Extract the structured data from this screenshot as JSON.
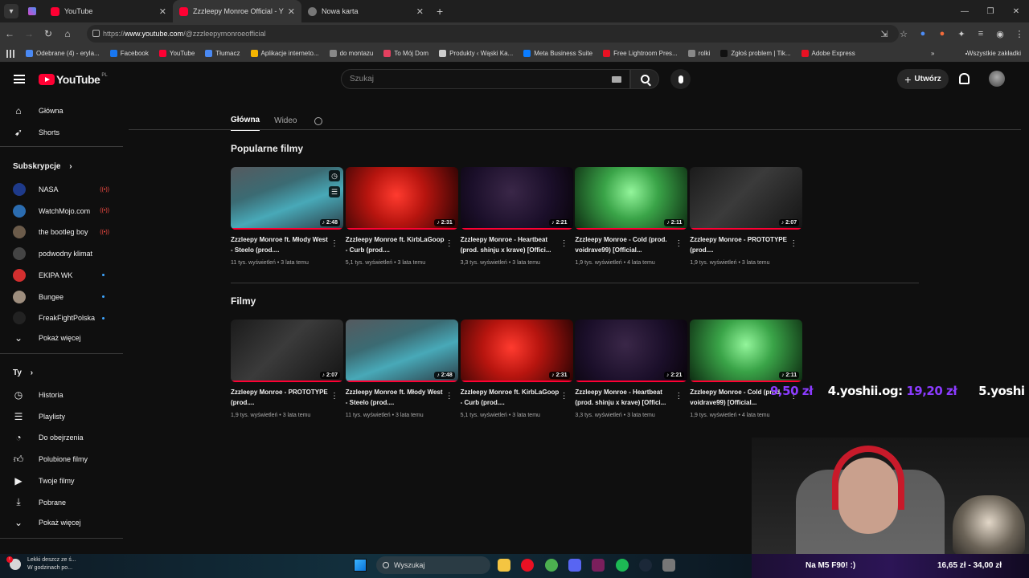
{
  "browser": {
    "tabs": [
      {
        "title": "YouTube",
        "active": false
      },
      {
        "title": "Zzzleepy Monroe Official - Y",
        "active": true
      },
      {
        "title": "Nowa karta",
        "active": false
      }
    ],
    "url_prefix": "https://",
    "url_host": "www.youtube.com",
    "url_path": "/@zzzleepymonroeofficial",
    "bookmarks": [
      {
        "label": "Odebrane (4) - eryla...",
        "color": "#4a89f3"
      },
      {
        "label": "Facebook",
        "color": "#1877f2"
      },
      {
        "label": "YouTube",
        "color": "#ff0033"
      },
      {
        "label": "Tłumacz",
        "color": "#4a89f3"
      },
      {
        "label": "Aplikacje interneto...",
        "color": "#f4b400"
      },
      {
        "label": "do montazu",
        "color": "#888888"
      },
      {
        "label": "To Mój Dom",
        "color": "#e4405f"
      },
      {
        "label": "Produkty ‹ Wąski Ka...",
        "color": "#cccccc"
      },
      {
        "label": "Meta Business Suite",
        "color": "#0a7cff"
      },
      {
        "label": "Free Lightroom Pres...",
        "color": "#e81123"
      },
      {
        "label": "rolki",
        "color": "#888888"
      },
      {
        "label": "Zgłoś problem | Tik...",
        "color": "#111111"
      },
      {
        "label": "Adobe Express",
        "color": "#e81123"
      }
    ],
    "all_bookmarks": "Wszystkie zakładki"
  },
  "header": {
    "logo": "YouTube",
    "country": "PL",
    "search_placeholder": "Szukaj",
    "create_label": "Utwórz"
  },
  "sidebar": {
    "main": [
      {
        "label": "Główna",
        "icon": "home-icon"
      },
      {
        "label": "Shorts",
        "icon": "shorts-icon"
      }
    ],
    "subs_title": "Subskrypcje",
    "subs": [
      {
        "label": "NASA",
        "color": "#1e3a8a",
        "status": "live"
      },
      {
        "label": "WatchMojo.com",
        "color": "#2b6cb0",
        "status": "live"
      },
      {
        "label": "the bootleg boy",
        "color": "#6b5b4a",
        "status": "live"
      },
      {
        "label": "podwodny klimat",
        "color": "#444444",
        "status": "none"
      },
      {
        "label": "EKIPA WK",
        "color": "#d32f2f",
        "status": "dot"
      },
      {
        "label": "Bungee",
        "color": "#9e8e7e",
        "status": "dot"
      },
      {
        "label": "FreakFightPolska",
        "color": "#222222",
        "status": "dot"
      }
    ],
    "show_more": "Pokaż więcej",
    "you_title": "Ty",
    "you": [
      {
        "label": "Historia",
        "icon": "history-icon"
      },
      {
        "label": "Playlisty",
        "icon": "playlists-icon"
      },
      {
        "label": "Do obejrzenia",
        "icon": "watch-later-icon"
      },
      {
        "label": "Polubione filmy",
        "icon": "like-icon"
      },
      {
        "label": "Twoje filmy",
        "icon": "your-videos-icon"
      },
      {
        "label": "Pobrane",
        "icon": "download-icon"
      }
    ],
    "show_more_2": "Pokaż więcej"
  },
  "channel_tabs": {
    "home": "Główna",
    "videos": "Wideo"
  },
  "sections": [
    {
      "title": "Popularne filmy",
      "videos": [
        {
          "title": "Zzzleepy Monroe ft. Młody West - Steelo (prod....",
          "meta": "11 tys. wyświetleń • 3 lata temu",
          "duration": "♪ 2:48",
          "thumb": "th-blue"
        },
        {
          "title": "Zzzleepy Monroe ft. KirbLaGoop - Curb (prod....",
          "meta": "5,1 tys. wyświetleń • 3 lata temu",
          "duration": "♪ 2:31",
          "thumb": "th-red"
        },
        {
          "title": "Zzzleepy Monroe - Heartbeat (prod. shinju x krave) [Offici...",
          "meta": "3,3 tys. wyświetleń • 3 lata temu",
          "duration": "♪ 2:21",
          "thumb": "th-purple"
        },
        {
          "title": "Zzzleepy Monroe - Cold (prod. voidrave99) [Official...",
          "meta": "1,9 tys. wyświetleń • 4 lata temu",
          "duration": "♪ 2:11",
          "thumb": "th-green"
        },
        {
          "title": "Zzzleepy Monroe - PROTOTYPE (prod....",
          "meta": "1,9 tys. wyświetleń • 3 lata temu",
          "duration": "♪ 2:07",
          "thumb": "th-dark"
        }
      ]
    },
    {
      "title": "Filmy",
      "videos": [
        {
          "title": "Zzzleepy Monroe - PROTOTYPE (prod....",
          "meta": "1,9 tys. wyświetleń • 3 lata temu",
          "duration": "♪ 2:07",
          "thumb": "th-dark"
        },
        {
          "title": "Zzzleepy Monroe ft. Młody West - Steelo (prod....",
          "meta": "11 tys. wyświetleń • 3 lata temu",
          "duration": "♪ 2:48",
          "thumb": "th-blue"
        },
        {
          "title": "Zzzleepy Monroe ft. KirbLaGoop - Curb (prod....",
          "meta": "5,1 tys. wyświetleń • 3 lata temu",
          "duration": "♪ 2:31",
          "thumb": "th-red"
        },
        {
          "title": "Zzzleepy Monroe - Heartbeat (prod. shinju x krave) [Offici...",
          "meta": "3,3 tys. wyświetleń • 3 lata temu",
          "duration": "♪ 2:21",
          "thumb": "th-purple"
        },
        {
          "title": "Zzzleepy Monroe - Cold (prod. voidrave99) [Official...",
          "meta": "1,9 tys. wyświetleń • 4 lata temu",
          "duration": "♪ 2:11",
          "thumb": "th-green"
        }
      ]
    }
  ],
  "stream_overlay": {
    "donation_prev_amount": "9,50 zł",
    "donation_4_name": "4.yoshii.og:",
    "donation_4_amount": "19,20 zł",
    "donation_5_name": "5.yoshi",
    "goal_text": "Na M5 F90! :)",
    "goal_progress": "16,65 zł - 34,00 zł"
  },
  "taskbar": {
    "weather_line1": "Lekki deszcz ze ś...",
    "weather_line2": "W godzinach po...",
    "search_label": "Wyszukaj",
    "apps": [
      {
        "name": "file-explorer-icon",
        "color": "#f4c542"
      },
      {
        "name": "opera-icon",
        "color": "#e81123"
      },
      {
        "name": "chrome-icon",
        "color": "#4caf50"
      },
      {
        "name": "discord-icon",
        "color": "#5865f2"
      },
      {
        "name": "next-app-icon",
        "color": "#7a1f5c"
      },
      {
        "name": "spotify-icon",
        "color": "#1db954"
      },
      {
        "name": "steam-icon",
        "color": "#1b2838"
      },
      {
        "name": "settings-icon",
        "color": "#777777"
      }
    ]
  }
}
